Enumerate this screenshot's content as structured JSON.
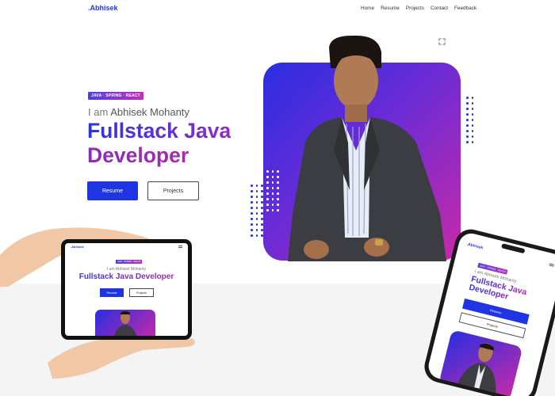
{
  "header": {
    "brand": ".Abhisek",
    "nav": [
      "Home",
      "Resume",
      "Projects",
      "Contact",
      "Feedback"
    ]
  },
  "hero": {
    "tag": "JAVA · SPRING · REACT",
    "intro_prefix": "I am ",
    "intro_name": "Abhisek Mohanty",
    "title_line1": "Fullstack Java",
    "title_line2": "Developer",
    "primary_button": "Resume",
    "secondary_button": "Projects"
  },
  "tablet": {
    "brand": ".Abhisek",
    "tag": "JAVA · SPRING · REACT",
    "intro": "I am Abhisek Mohanty",
    "title": "Fullstack Java Developer",
    "primary_button": "Resume",
    "secondary_button": "Projects"
  },
  "phone": {
    "brand": ".Abhisek",
    "tag": "JAVA · SPRING · REACT",
    "intro": "I am Abhisek Mohanty",
    "title": "Fullstack Java Developer",
    "primary_button": "Resume",
    "secondary_button": "Projects"
  },
  "colors": {
    "brand_blue": "#2436e0",
    "accent_purple": "#9d2ab4",
    "gradient_start": "#2a2ee0",
    "gradient_end": "#c82aa8"
  },
  "icons": [
    "expand-icon",
    "hamburger-menu-icon"
  ]
}
